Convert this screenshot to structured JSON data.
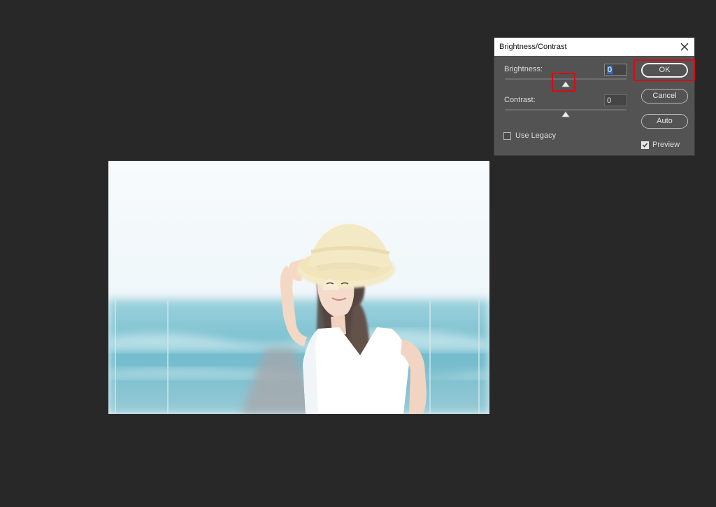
{
  "dialog": {
    "title": "Brightness/Contrast",
    "brightness": {
      "label": "Brightness:",
      "value": "0"
    },
    "contrast": {
      "label": "Contrast:",
      "value": "0"
    },
    "use_legacy": {
      "label": "Use Legacy",
      "checked": false
    },
    "preview": {
      "label": "Preview",
      "checked": true
    },
    "buttons": {
      "ok": "OK",
      "cancel": "Cancel",
      "auto": "Auto"
    }
  },
  "annotations": {
    "highlight_color": "#d40d16"
  },
  "colors": {
    "canvas_bg": "#282828",
    "dialog_bg": "#535353",
    "titlebar_bg": "#ffffff",
    "selection": "#2f6fc0"
  }
}
